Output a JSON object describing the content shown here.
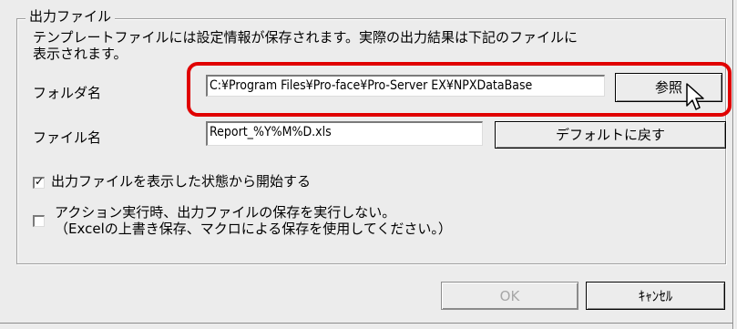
{
  "group": {
    "title": "出力ファイル",
    "description": "テンプレートファイルには設定情報が保存されます。実際の出力結果は下記のファイルに\n表示されます。"
  },
  "folder": {
    "label": "フォルダ名",
    "value": "C:¥Program Files¥Pro-face¥Pro-Server EX¥NPXDataBase",
    "browse_button": "参照"
  },
  "file": {
    "label": "ファイル名",
    "value": "Report_%Y%M%D.xls",
    "default_button": "デフォルトに戻す"
  },
  "options": [
    {
      "label": "出力ファイルを表示した状態から開始する",
      "checked": true
    },
    {
      "label": "アクション実行時、出力ファイルの保存を実行しない。\n（Excelの上書き保存、マクロによる保存を使用してください。）",
      "checked": false
    }
  ],
  "footer": {
    "ok_label": "OK",
    "cancel_label": "ｷｬﾝｾﾙ"
  },
  "colors": {
    "highlight": "#e00000",
    "window": "#ececec"
  }
}
